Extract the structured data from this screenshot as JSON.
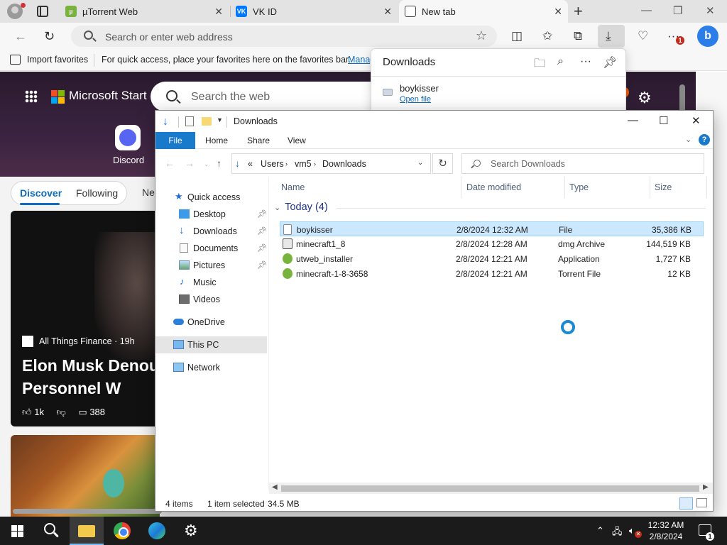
{
  "browser": {
    "tabs": [
      {
        "title": "µTorrent Web",
        "icon": "utorrent-icon",
        "color": "#78b43d"
      },
      {
        "title": "VK ID",
        "icon": "vk-icon",
        "color": "#0077ff"
      },
      {
        "title": "New tab",
        "icon": "newtab-icon",
        "color": "#ffffff"
      }
    ],
    "address_placeholder": "Search or enter web address",
    "downloads_badge": "1",
    "favorites_bar": {
      "import_label": "Import favorites",
      "message": "For quick access, place your favorites here on the favorites bar.",
      "manage_link": "Manag"
    }
  },
  "downloads_flyout": {
    "title": "Downloads",
    "items": [
      {
        "name": "boykisser",
        "action": "Open file"
      }
    ]
  },
  "page": {
    "brand": "Microsoft Start",
    "search_placeholder": "Search the web",
    "shortcut": {
      "label": "Discord"
    },
    "feed_tabs": {
      "discover": "Discover",
      "following": "Following",
      "next": "Ne"
    },
    "article": {
      "source": "All Things Finance · 19h",
      "headline": "Elon Musk Denou NGO Personnel W",
      "likes": "1k",
      "comments": "388"
    }
  },
  "explorer": {
    "title": "Downloads",
    "ribbon_tabs": {
      "file": "File",
      "home": "Home",
      "share": "Share",
      "view": "View"
    },
    "breadcrumb": {
      "prefix": "«",
      "items": [
        "Users",
        "vm5",
        "Downloads"
      ]
    },
    "search_placeholder": "Search Downloads",
    "nav": {
      "quick_access": "Quick access",
      "desktop": "Desktop",
      "downloads": "Downloads",
      "documents": "Documents",
      "pictures": "Pictures",
      "music": "Music",
      "videos": "Videos",
      "onedrive": "OneDrive",
      "this_pc": "This PC",
      "network": "Network"
    },
    "columns": {
      "name": "Name",
      "date": "Date modified",
      "type": "Type",
      "size": "Size"
    },
    "group": "Today (4)",
    "files": [
      {
        "name": "boykisser",
        "date": "2/8/2024 12:32 AM",
        "type": "File",
        "size": "35,386 KB"
      },
      {
        "name": "minecraft1_8",
        "date": "2/8/2024 12:28 AM",
        "type": "dmg Archive",
        "size": "144,519 KB"
      },
      {
        "name": "utweb_installer",
        "date": "2/8/2024 12:21 AM",
        "type": "Application",
        "size": "1,727 KB"
      },
      {
        "name": "minecraft-1-8-3658",
        "date": "2/8/2024 12:21 AM",
        "type": "Torrent File",
        "size": "12 KB"
      }
    ],
    "status": {
      "count": "4 items",
      "selected": "1 item selected",
      "size": "34.5 MB"
    }
  },
  "taskbar": {
    "time": "12:32 AM",
    "date": "2/8/2024",
    "notification_count": "1"
  }
}
